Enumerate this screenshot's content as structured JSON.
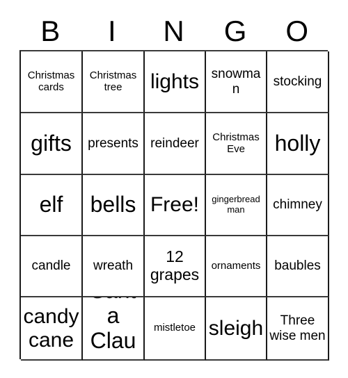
{
  "card": {
    "title": "BINGO",
    "header_letters": [
      "B",
      "I",
      "N",
      "G",
      "O"
    ],
    "free_space_label": "Free!",
    "colors": {
      "background": "#ffffff",
      "text": "#000000",
      "grid_line": "#1a1a1a"
    },
    "rows": [
      [
        {
          "label": "Christmas cards",
          "size": "sm"
        },
        {
          "label": "Christmas tree",
          "size": "sm"
        },
        {
          "label": "lights",
          "size": "xl"
        },
        {
          "label": "snowman",
          "size": "md"
        },
        {
          "label": "stocking",
          "size": "md"
        }
      ],
      [
        {
          "label": "gifts",
          "size": "xxl"
        },
        {
          "label": "presents",
          "size": "md"
        },
        {
          "label": "reindeer",
          "size": "md"
        },
        {
          "label": "Christmas Eve",
          "size": "sm"
        },
        {
          "label": "holly",
          "size": "xxl"
        }
      ],
      [
        {
          "label": "elf",
          "size": "xxl"
        },
        {
          "label": "bells",
          "size": "xxl"
        },
        {
          "label": "Free!",
          "size": "xl"
        },
        {
          "label": "gingerbread man",
          "size": "xs"
        },
        {
          "label": "chimney",
          "size": "md"
        }
      ],
      [
        {
          "label": "candle",
          "size": "md"
        },
        {
          "label": "wreath",
          "size": "md"
        },
        {
          "label": "12 grapes",
          "size": "lg"
        },
        {
          "label": "ornaments",
          "size": "sm"
        },
        {
          "label": "baubles",
          "size": "md"
        }
      ],
      [
        {
          "label": "candy cane",
          "size": "xl"
        },
        {
          "label": "Santa Claus",
          "size": "xxl"
        },
        {
          "label": "mistletoe",
          "size": "sm"
        },
        {
          "label": "sleigh",
          "size": "xl"
        },
        {
          "label": "Three wise men",
          "size": "md"
        }
      ]
    ]
  }
}
